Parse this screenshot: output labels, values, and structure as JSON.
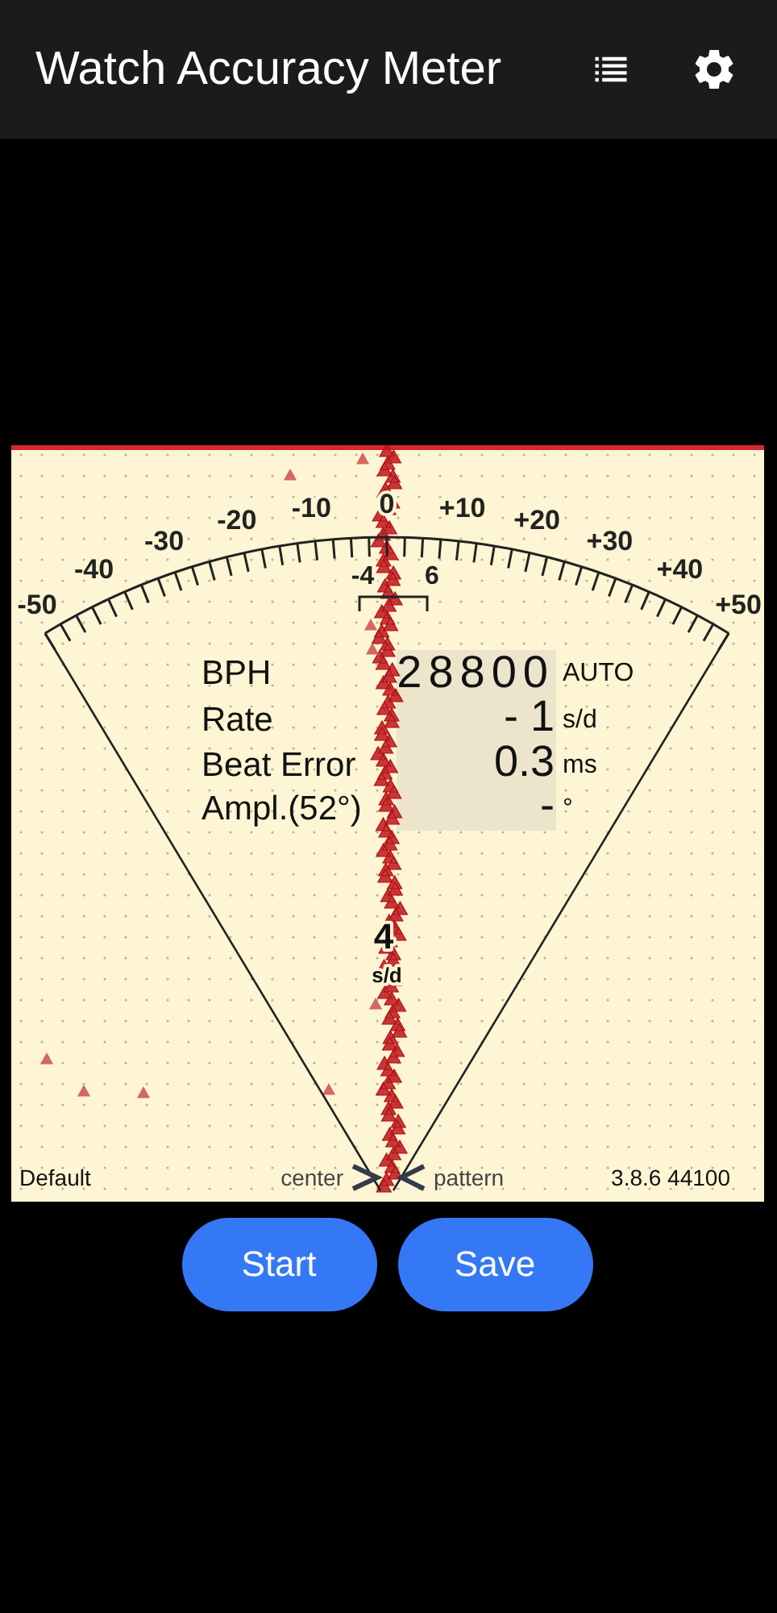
{
  "app_bar": {
    "title": "Watch Accuracy Meter"
  },
  "meter": {
    "scale_labels": [
      "-50",
      "-40",
      "-30",
      "-20",
      "-10",
      "0",
      "+10",
      "+20",
      "+30",
      "+40",
      "+50"
    ],
    "window_labels": [
      "-4",
      "6"
    ],
    "readings": [
      {
        "label": "BPH",
        "value": "28800",
        "unit": "AUTO",
        "kind": "digits"
      },
      {
        "label": "Rate",
        "value": "- 1",
        "unit": "s/d",
        "kind": "plain"
      },
      {
        "label": "Beat Error",
        "value": "0.3",
        "unit": "ms",
        "kind": "plain"
      },
      {
        "label": "Ampl.(52°)",
        "value": "-",
        "unit": "°",
        "kind": "plain"
      }
    ],
    "rate_marker": {
      "value": "4",
      "unit": "s/d"
    },
    "footer": {
      "profile": "Default",
      "left_hint": "center",
      "right_hint": "pattern",
      "version": "3.8.6 44100"
    }
  },
  "buttons": [
    "Start",
    "Save"
  ]
}
